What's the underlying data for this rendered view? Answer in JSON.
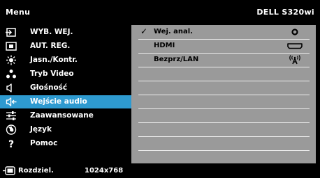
{
  "header": {
    "title": "Menu",
    "model": "DELL S320wi"
  },
  "menu": {
    "items": [
      {
        "label": "WYB. WEJ.",
        "icon": "input-select-icon"
      },
      {
        "label": "AUT. REG.",
        "icon": "auto-adjust-icon"
      },
      {
        "label": "Jasn./Kontr.",
        "icon": "brightness-icon"
      },
      {
        "label": "Tryb Video",
        "icon": "video-mode-icon"
      },
      {
        "label": "Głośność",
        "icon": "volume-icon"
      },
      {
        "label": "Wejście audio",
        "icon": "audio-input-icon",
        "selected": true
      },
      {
        "label": "Zaawansowane",
        "icon": "advanced-settings-icon"
      },
      {
        "label": "Język",
        "icon": "language-icon"
      },
      {
        "label": "Pomoc",
        "icon": "help-icon"
      }
    ]
  },
  "audio_input": {
    "options": [
      {
        "label": "Wej. anal.",
        "checked": true,
        "icon": "analog-audio-icon"
      },
      {
        "label": "HDMI",
        "checked": false,
        "icon": "hdmi-icon"
      },
      {
        "label": "Bezprz/LAN",
        "checked": false,
        "icon": "wireless-icon"
      }
    ],
    "check_mark": "✓"
  },
  "status": {
    "label": "Rozdziel.",
    "value": "1024x768",
    "icon": "resolution-icon"
  },
  "colors": {
    "selected": "#2e9ad0",
    "panel": "#9a9a9a",
    "background": "#000000"
  }
}
